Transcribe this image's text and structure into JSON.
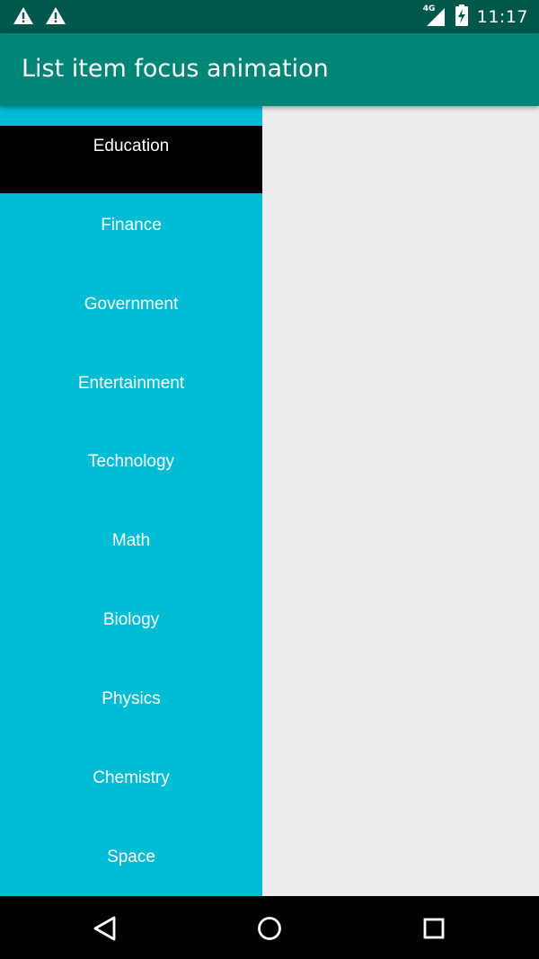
{
  "status_bar": {
    "time": "11:17",
    "network_label": "4G",
    "icons": [
      "warning-icon",
      "warning-icon",
      "signal-icon",
      "battery-charging-icon"
    ]
  },
  "app_bar": {
    "title": "List item focus animation"
  },
  "list": {
    "items": [
      {
        "label": "Education",
        "focused": true
      },
      {
        "label": "Finance"
      },
      {
        "label": "Government"
      },
      {
        "label": "Entertainment"
      },
      {
        "label": "Technology"
      },
      {
        "label": "Math"
      },
      {
        "label": "Biology"
      },
      {
        "label": "Physics"
      },
      {
        "label": "Chemistry"
      },
      {
        "label": "Space"
      }
    ]
  },
  "nav_bar": {
    "icons": [
      "back-icon",
      "home-icon",
      "recents-icon"
    ]
  },
  "colors": {
    "status_bar": "#00574B",
    "app_bar": "#008577",
    "list_panel": "#00BCD4",
    "focused_item": "#000000",
    "background": "#ECEBEE"
  }
}
